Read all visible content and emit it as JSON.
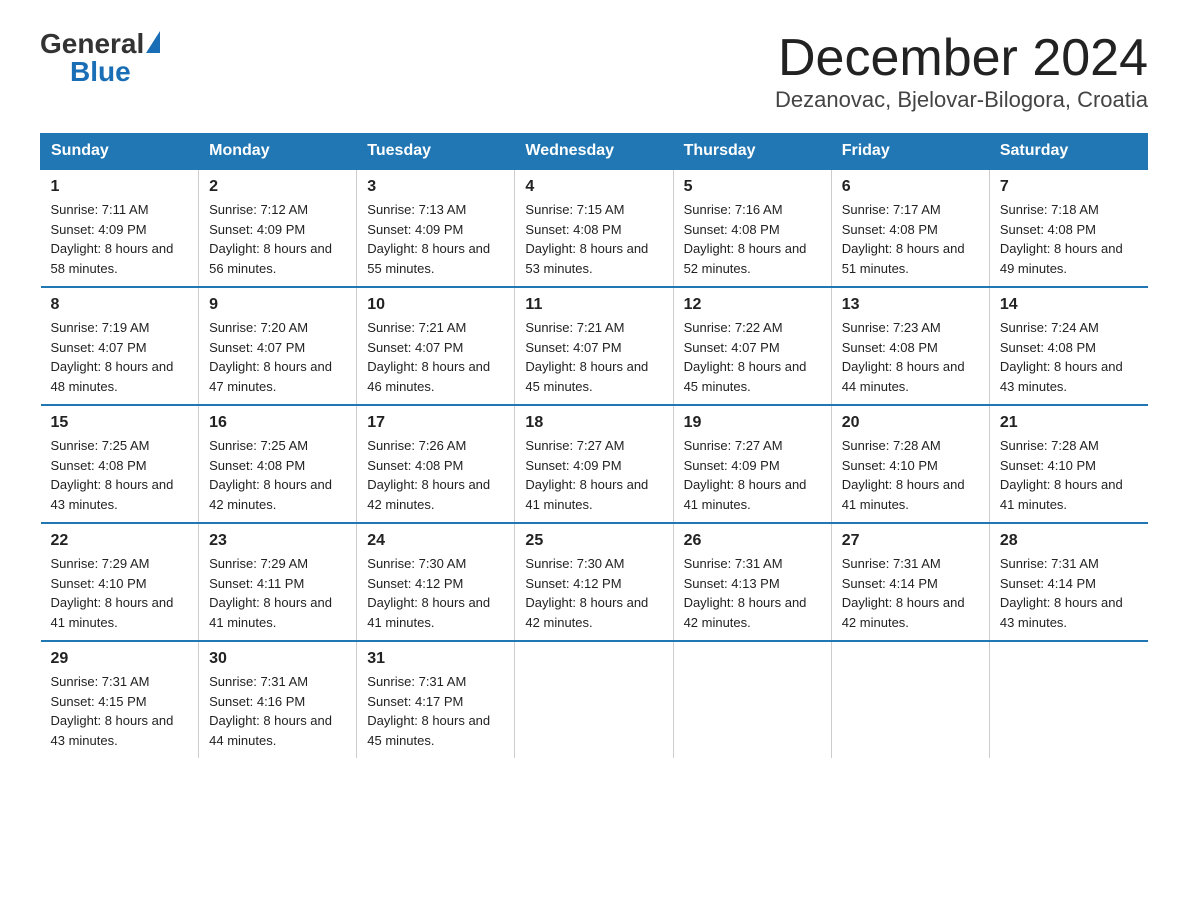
{
  "logo": {
    "general": "General",
    "blue": "Blue",
    "triangle": true
  },
  "title": "December 2024",
  "subtitle": "Dezanovac, Bjelovar-Bilogora, Croatia",
  "days_of_week": [
    "Sunday",
    "Monday",
    "Tuesday",
    "Wednesday",
    "Thursday",
    "Friday",
    "Saturday"
  ],
  "weeks": [
    [
      {
        "day": "1",
        "sunrise": "7:11 AM",
        "sunset": "4:09 PM",
        "daylight": "8 hours and 58 minutes."
      },
      {
        "day": "2",
        "sunrise": "7:12 AM",
        "sunset": "4:09 PM",
        "daylight": "8 hours and 56 minutes."
      },
      {
        "day": "3",
        "sunrise": "7:13 AM",
        "sunset": "4:09 PM",
        "daylight": "8 hours and 55 minutes."
      },
      {
        "day": "4",
        "sunrise": "7:15 AM",
        "sunset": "4:08 PM",
        "daylight": "8 hours and 53 minutes."
      },
      {
        "day": "5",
        "sunrise": "7:16 AM",
        "sunset": "4:08 PM",
        "daylight": "8 hours and 52 minutes."
      },
      {
        "day": "6",
        "sunrise": "7:17 AM",
        "sunset": "4:08 PM",
        "daylight": "8 hours and 51 minutes."
      },
      {
        "day": "7",
        "sunrise": "7:18 AM",
        "sunset": "4:08 PM",
        "daylight": "8 hours and 49 minutes."
      }
    ],
    [
      {
        "day": "8",
        "sunrise": "7:19 AM",
        "sunset": "4:07 PM",
        "daylight": "8 hours and 48 minutes."
      },
      {
        "day": "9",
        "sunrise": "7:20 AM",
        "sunset": "4:07 PM",
        "daylight": "8 hours and 47 minutes."
      },
      {
        "day": "10",
        "sunrise": "7:21 AM",
        "sunset": "4:07 PM",
        "daylight": "8 hours and 46 minutes."
      },
      {
        "day": "11",
        "sunrise": "7:21 AM",
        "sunset": "4:07 PM",
        "daylight": "8 hours and 45 minutes."
      },
      {
        "day": "12",
        "sunrise": "7:22 AM",
        "sunset": "4:07 PM",
        "daylight": "8 hours and 45 minutes."
      },
      {
        "day": "13",
        "sunrise": "7:23 AM",
        "sunset": "4:08 PM",
        "daylight": "8 hours and 44 minutes."
      },
      {
        "day": "14",
        "sunrise": "7:24 AM",
        "sunset": "4:08 PM",
        "daylight": "8 hours and 43 minutes."
      }
    ],
    [
      {
        "day": "15",
        "sunrise": "7:25 AM",
        "sunset": "4:08 PM",
        "daylight": "8 hours and 43 minutes."
      },
      {
        "day": "16",
        "sunrise": "7:25 AM",
        "sunset": "4:08 PM",
        "daylight": "8 hours and 42 minutes."
      },
      {
        "day": "17",
        "sunrise": "7:26 AM",
        "sunset": "4:08 PM",
        "daylight": "8 hours and 42 minutes."
      },
      {
        "day": "18",
        "sunrise": "7:27 AM",
        "sunset": "4:09 PM",
        "daylight": "8 hours and 41 minutes."
      },
      {
        "day": "19",
        "sunrise": "7:27 AM",
        "sunset": "4:09 PM",
        "daylight": "8 hours and 41 minutes."
      },
      {
        "day": "20",
        "sunrise": "7:28 AM",
        "sunset": "4:10 PM",
        "daylight": "8 hours and 41 minutes."
      },
      {
        "day": "21",
        "sunrise": "7:28 AM",
        "sunset": "4:10 PM",
        "daylight": "8 hours and 41 minutes."
      }
    ],
    [
      {
        "day": "22",
        "sunrise": "7:29 AM",
        "sunset": "4:10 PM",
        "daylight": "8 hours and 41 minutes."
      },
      {
        "day": "23",
        "sunrise": "7:29 AM",
        "sunset": "4:11 PM",
        "daylight": "8 hours and 41 minutes."
      },
      {
        "day": "24",
        "sunrise": "7:30 AM",
        "sunset": "4:12 PM",
        "daylight": "8 hours and 41 minutes."
      },
      {
        "day": "25",
        "sunrise": "7:30 AM",
        "sunset": "4:12 PM",
        "daylight": "8 hours and 42 minutes."
      },
      {
        "day": "26",
        "sunrise": "7:31 AM",
        "sunset": "4:13 PM",
        "daylight": "8 hours and 42 minutes."
      },
      {
        "day": "27",
        "sunrise": "7:31 AM",
        "sunset": "4:14 PM",
        "daylight": "8 hours and 42 minutes."
      },
      {
        "day": "28",
        "sunrise": "7:31 AM",
        "sunset": "4:14 PM",
        "daylight": "8 hours and 43 minutes."
      }
    ],
    [
      {
        "day": "29",
        "sunrise": "7:31 AM",
        "sunset": "4:15 PM",
        "daylight": "8 hours and 43 minutes."
      },
      {
        "day": "30",
        "sunrise": "7:31 AM",
        "sunset": "4:16 PM",
        "daylight": "8 hours and 44 minutes."
      },
      {
        "day": "31",
        "sunrise": "7:31 AM",
        "sunset": "4:17 PM",
        "daylight": "8 hours and 45 minutes."
      },
      null,
      null,
      null,
      null
    ]
  ]
}
